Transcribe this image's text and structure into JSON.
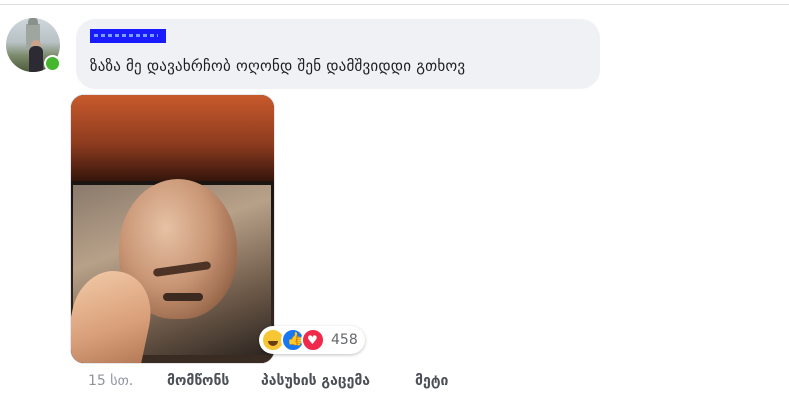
{
  "comment": {
    "author_name": "",
    "text": "ზაზა მე დავახრჩობ ოღონდ შენ დამშვიდდი გთხოვ",
    "reaction_count": "458",
    "reactions": [
      "haha-icon",
      "like-icon",
      "love-icon"
    ],
    "timestamp": "15 სთ.",
    "actions": {
      "like": "მომწონს",
      "reply": "პასუხის გაცემა",
      "more": "მეტი"
    }
  },
  "colors": {
    "bubble": "#eff1f4",
    "online": "#44b72f",
    "like": "#1877f2",
    "love": "#f0284a",
    "haha": "#f7c634"
  }
}
